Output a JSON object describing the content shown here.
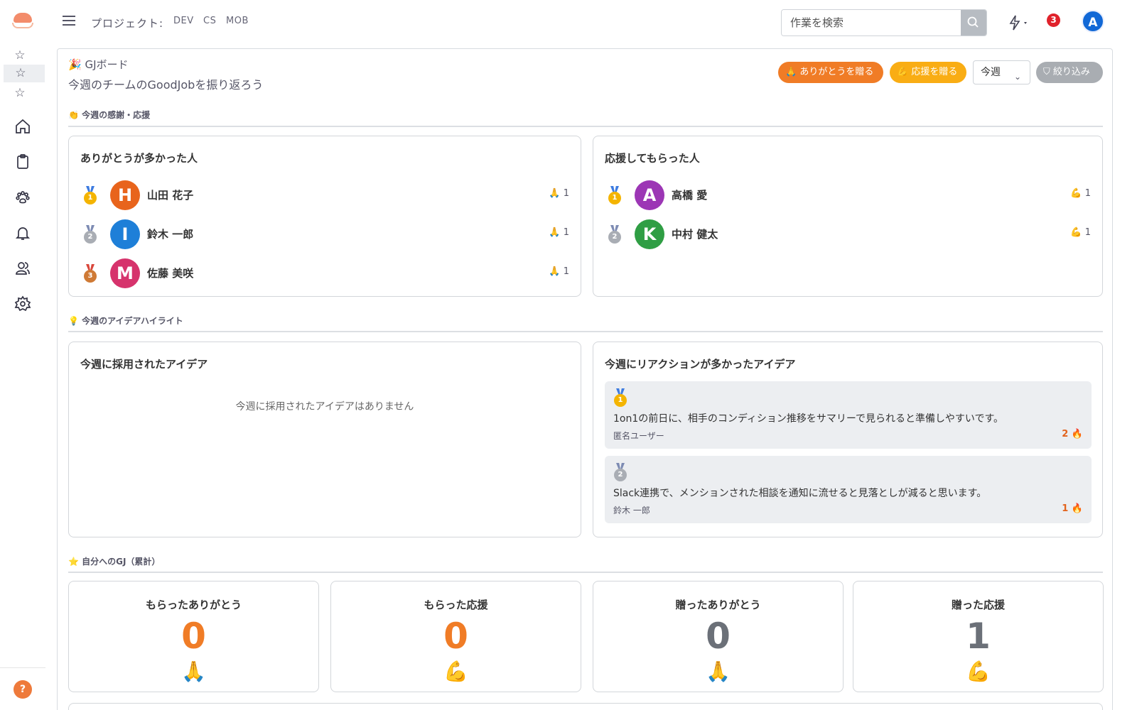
{
  "header": {
    "project_label": "プロジェクト:",
    "projects": [
      "DEV",
      "CS",
      "MOB"
    ],
    "search_placeholder": "作業を検索",
    "notification_count": "3",
    "user_initial": "A"
  },
  "page": {
    "title": "🎉 GJボード",
    "subtitle": "今週のチームのGoodJobを振り返ろう",
    "buttons": {
      "thanks": "🙏 ありがとうを贈る",
      "cheer": "💪 応援を贈る",
      "filter": "絞り込み"
    },
    "period": "今週"
  },
  "sections": {
    "appreciation": "👏 今週の感謝・応援",
    "ideas": "💡 今週のアイデアハイライト",
    "mine": "⭐ 自分へのGJ（累計）"
  },
  "thanks_card": {
    "title": "ありがとうが多かった人",
    "people": [
      {
        "initial": "H",
        "name": "山田 花子",
        "count": "🙏 1",
        "color": "#e8641c",
        "rank": "1"
      },
      {
        "initial": "I",
        "name": "鈴木 一郎",
        "count": "🙏 1",
        "color": "#1e7fd8",
        "rank": "2"
      },
      {
        "initial": "M",
        "name": "佐藤 美咲",
        "count": "🙏 1",
        "color": "#d6336c",
        "rank": "3"
      }
    ]
  },
  "cheer_card": {
    "title": "応援してもらった人",
    "people": [
      {
        "initial": "A",
        "name": "高橋 愛",
        "count": "💪 1",
        "color": "#9c36b5",
        "rank": "1"
      },
      {
        "initial": "K",
        "name": "中村 健太",
        "count": "💪 1",
        "color": "#2f9e44",
        "rank": "2"
      }
    ]
  },
  "adopted_card": {
    "title": "今週に採用されたアイデア",
    "empty": "今週に採用されたアイデアはありません"
  },
  "reaction_card": {
    "title": "今週にリアクションが多かったアイデア",
    "ideas": [
      {
        "text": "1on1の前日に、相手のコンディション推移をサマリーで見られると準備しやすいです。",
        "author": "匿名ユーザー",
        "reactions": "2 🔥",
        "rank": "1"
      },
      {
        "text": "Slack連携で、メンションされた相談を通知に流せると見落としが減ると思います。",
        "author": "鈴木 一郎",
        "reactions": "1 🔥",
        "rank": "2"
      }
    ]
  },
  "stats": [
    {
      "label": "もらったありがとう",
      "value": "0",
      "emoji": "🙏",
      "color": "#f07c26"
    },
    {
      "label": "もらった応援",
      "value": "0",
      "emoji": "💪",
      "color": "#f07c26"
    },
    {
      "label": "贈ったありがとう",
      "value": "0",
      "emoji": "🙏",
      "color": "#6b7078"
    },
    {
      "label": "贈った応援",
      "value": "1",
      "emoji": "💪",
      "color": "#6b7078"
    }
  ]
}
